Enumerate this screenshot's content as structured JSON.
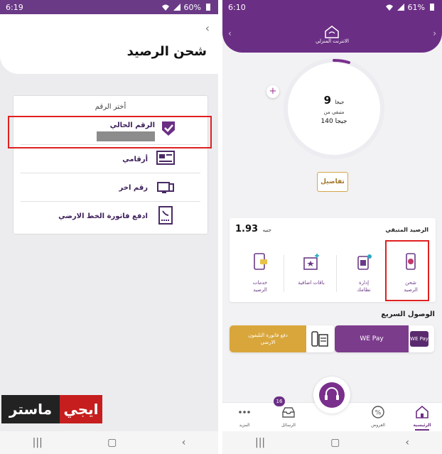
{
  "left_screen": {
    "status": {
      "time": "6:19",
      "battery": "60%"
    },
    "header": {
      "title": "شحن الرصيد"
    },
    "card": {
      "heading": "أختر الرقم",
      "current_number_label": "الرقم الحالي",
      "my_numbers_label": "أرقامي",
      "other_number_label": "رقم اخر",
      "landline_bill_label": "ادفع فاتورة الخط الارضي"
    },
    "logo": {
      "part_dark": "ماستر",
      "part_red": "ايجي"
    }
  },
  "right_screen": {
    "status": {
      "time": "6:10",
      "battery": "61%"
    },
    "header": {
      "title": "الانترنت المنزلي"
    },
    "quota": {
      "remaining_value": "9",
      "remaining_unit": "جيجا",
      "remaining_of": "متبقي من",
      "total": "140 جيجا"
    },
    "details_button": "تفاصيل",
    "balance": {
      "title": "الرصيد المتبقي",
      "amount": "1.93",
      "currency": "جنيه",
      "services": [
        {
          "label_1": "شحن",
          "label_2": "الرصيد",
          "icon": "phone-recharge-icon"
        },
        {
          "label_1": "إدارة",
          "label_2": "نظامك",
          "icon": "sim-manage-icon"
        },
        {
          "label_1": "باقات اضافية",
          "label_2": "",
          "icon": "extra-bundles-icon"
        },
        {
          "label_1": "خدمات",
          "label_2": "الرصيد",
          "icon": "balance-services-icon"
        }
      ]
    },
    "quick_access": {
      "title": "الوصول السريع",
      "we_pay_label": "WE Pay",
      "we_pay_badge": "WE Pay",
      "landline_bill_line1": "دفع فاتورة التليفون",
      "landline_bill_line2": "الارضي"
    },
    "bottom_nav": {
      "home": "الرئيسية",
      "offers": "العروض",
      "messages": "الرسائل",
      "messages_count": "16",
      "more": "المزيد"
    }
  },
  "colors": {
    "brand_purple": "#6b2e85",
    "highlight_red": "#e02020",
    "gold": "#d9a63b"
  }
}
